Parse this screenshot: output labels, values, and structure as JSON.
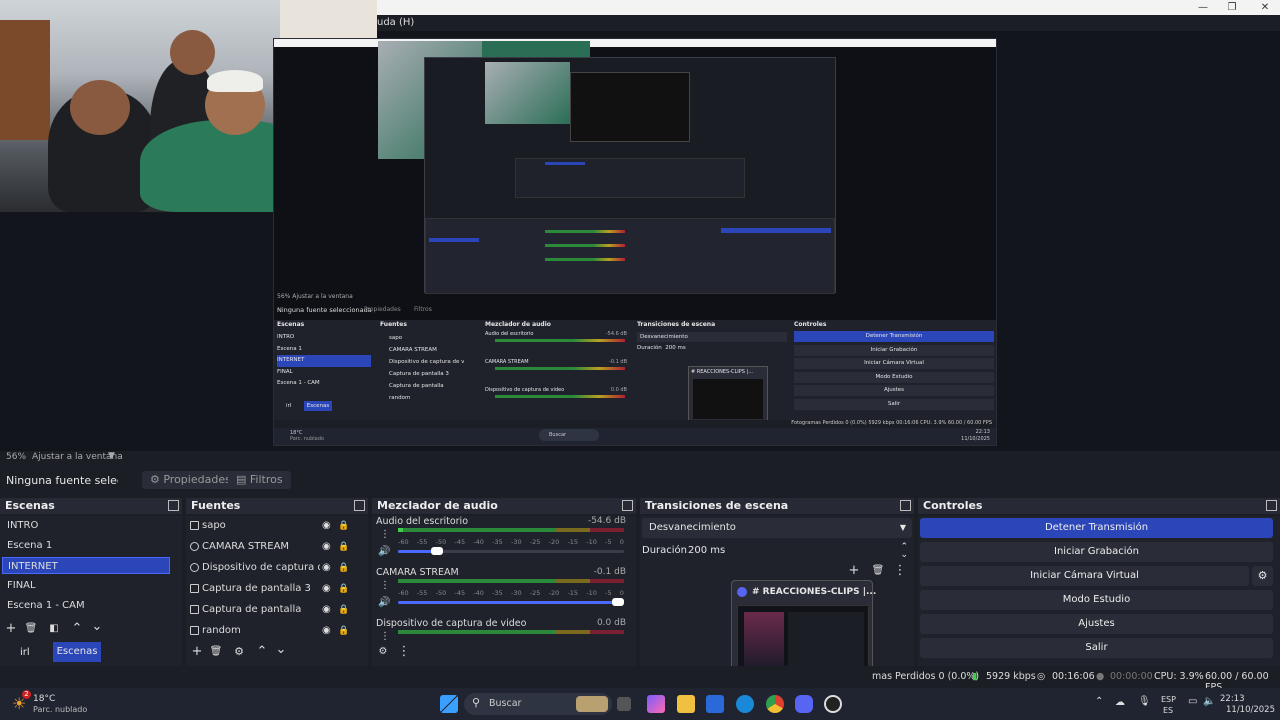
{
  "window": {
    "menu_fragment": "uda (H)",
    "minimize": "—",
    "maximize": "❐",
    "close": "✕"
  },
  "preview": {
    "zoom": "56%",
    "fit_label": "Ajustar a la ventana",
    "inner_zoom": "56%",
    "inner_fit": "Ajustar a la ventana",
    "inner_no_source": "Ninguna fuente seleccionada",
    "inner_props": "Propiedades",
    "inner_filters": "Filtros",
    "inner_scenes_title": "Escenas",
    "inner_sources_title": "Fuentes",
    "inner_mixer_title": "Mezclador de audio",
    "inner_transitions_title": "Transiciones de escena",
    "inner_controls_title": "Controles",
    "inner_scenes": [
      "INTRO",
      "Escena 1",
      "INTERNET",
      "FINAL",
      "Escena 1 - CAM"
    ],
    "inner_sources": [
      "sapo",
      "CAMARA STREAM",
      "Dispositivo de captura de vid",
      "Captura de pantalla 3",
      "Captura de pantalla",
      "random"
    ],
    "inner_mixer": [
      {
        "name": "Audio del escritorio",
        "db": "-54.6 dB"
      },
      {
        "name": "CAMARA STREAM",
        "db": "-0.1 dB"
      },
      {
        "name": "Dispositivo de captura de video",
        "db": "0.0 dB"
      }
    ],
    "inner_transition": "Desvanecimiento",
    "inner_duration_label": "Duración",
    "inner_duration": "200 ms",
    "inner_controls": [
      "Detener Transmisión",
      "Iniciar Grabación",
      "Iniciar Cámara Virtual",
      "Modo Estudio",
      "Ajustes",
      "Salir"
    ],
    "inner_popup": "# REACCIONES-CLIPS |...",
    "inner_status": "Fotogramas Perdidos 0 (0.0%)   5929 kbps   00:16:06   CPU: 3.9%   60.00 / 60.00 FPS",
    "inner_tabs": [
      "irl",
      "Escenas"
    ],
    "inner_weather": "18°C",
    "inner_weather_desc": "Parc. nublado",
    "inner_search": "Buscar",
    "inner_time": "22:13",
    "inner_date": "11/10/2025"
  },
  "props_bar": {
    "no_source": "Ninguna fuente seleccionad",
    "properties": "Propiedades",
    "filters": "Filtros"
  },
  "scenes": {
    "title": "Escenas",
    "items": [
      "INTRO",
      "Escena 1",
      "INTERNET",
      "FINAL",
      "Escena 1 - CAM"
    ],
    "selected": "INTERNET",
    "tabs": [
      "irl",
      "Escenas"
    ]
  },
  "sources": {
    "title": "Fuentes",
    "items": [
      "sapo",
      "CAMARA STREAM",
      "Dispositivo de captura de vid",
      "Captura de pantalla 3",
      "Captura de pantalla",
      "random"
    ]
  },
  "mixer": {
    "title": "Mezclador de audio",
    "channels": [
      {
        "name": "Audio del escritorio",
        "db": "-54.6 dB",
        "level": 0.02,
        "volume": 0.2
      },
      {
        "name": "CAMARA STREAM",
        "db": "-0.1 dB",
        "level": 0.0,
        "volume": 1.0
      },
      {
        "name": "Dispositivo de captura de video",
        "db": "0.0 dB",
        "level": 0.0,
        "volume": 1.0
      }
    ],
    "ticks": [
      "-60",
      "-55",
      "-50",
      "-45",
      "-40",
      "-35",
      "-30",
      "-25",
      "-20",
      "-15",
      "-10",
      "-5",
      "0"
    ]
  },
  "transitions": {
    "title": "Transiciones de escena",
    "selected": "Desvanecimiento",
    "duration_label": "Duración",
    "duration": "200 ms"
  },
  "popup": {
    "title": "# REACCIONES-CLIPS |..."
  },
  "controls": {
    "title": "Controles",
    "buttons": [
      "Detener Transmisión",
      "Iniciar Grabación",
      "Iniciar Cámara Virtual",
      "Modo Estudio",
      "Ajustes",
      "Salir"
    ]
  },
  "status": {
    "dropped": "mas Perdidos 0 (0.0%)",
    "kbps": "5929 kbps",
    "stream_time": "00:16:06",
    "rec_time": "00:00:00",
    "cpu": "CPU: 3.9%",
    "fps": "60.00 / 60.00 FPS"
  },
  "taskbar": {
    "temp": "18°C",
    "weather": "Parc. nublado",
    "weather_badge": "2",
    "search": "Buscar",
    "lang1": "ESP",
    "lang2": "ES",
    "time": "22:13",
    "date": "11/10/2025"
  },
  "colors": {
    "accent": "#2b46b8",
    "bg": "#1c1e26",
    "panel": "#1f222b"
  }
}
